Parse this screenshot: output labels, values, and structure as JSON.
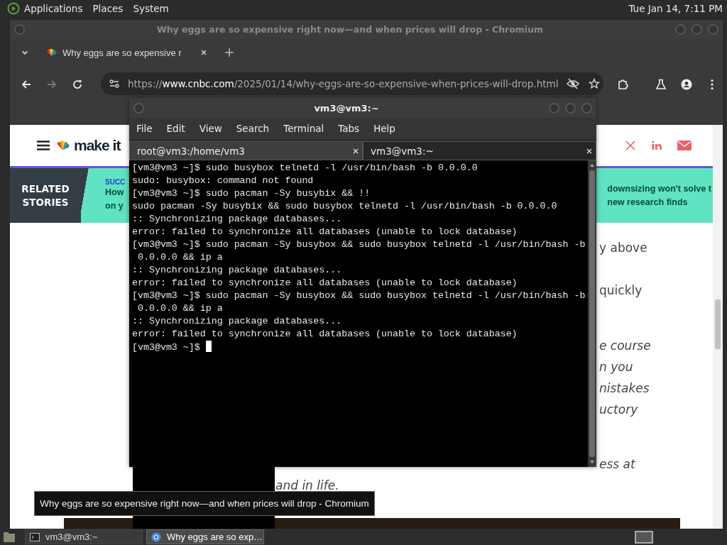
{
  "top_panel": {
    "menus": [
      "Applications",
      "Places",
      "System"
    ],
    "clock": "Tue Jan 14,  7:11 PM"
  },
  "browser": {
    "title": "Why eggs are so expensive right now—and when prices will drop - Chromium",
    "tab": {
      "title": "Why eggs are so expensive r"
    },
    "nav": {
      "forward_disabled": true
    },
    "url": {
      "scheme": "https://",
      "host": "www.cnbc.com",
      "path": "/2025/01/14/why-eggs-are-so-expensive-when-prices-will-drop.html"
    },
    "page": {
      "logo": "make it",
      "related": {
        "heading": "RELATED STORIES",
        "left_kicker": "SUCC",
        "left_lines": [
          "How",
          "on y"
        ],
        "right_lines": [
          "downsizing won't solve t",
          "new research finds"
        ]
      },
      "fragments": [
        {
          "text": "y above",
          "kind": "plain"
        },
        {
          "text": "quickly",
          "kind": "plain"
        },
        {
          "text": "e course",
          "kind": "italic"
        },
        {
          "text": "n you",
          "kind": "italic"
        },
        {
          "text": "nistakes",
          "kind": "italic"
        },
        {
          "text": "uctory",
          "kind": "italic"
        },
        {
          "text": "ess at",
          "kind": "italic"
        },
        {
          "text": "and in life.",
          "kind": "italic"
        }
      ]
    }
  },
  "terminal": {
    "title": "vm3@vm3:~",
    "menu": [
      "File",
      "Edit",
      "View",
      "Search",
      "Terminal",
      "Tabs",
      "Help"
    ],
    "tabs": [
      {
        "label": "root@vm3:/home/vm3",
        "selected": false
      },
      {
        "label": "vm3@vm3:~",
        "selected": true
      }
    ],
    "lines": [
      "[vm3@vm3 ~]$ sudo busybox telnetd -l /usr/bin/bash -b 0.0.0.0",
      "sudo: busybox: command not found",
      "[vm3@vm3 ~]$ sudo pacman -Sy busybix && !!",
      "sudo pacman -Sy busybix && sudo busybox telnetd -l /usr/bin/bash -b 0.0.0.0",
      ":: Synchronizing package databases...",
      "error: failed to synchronize all databases (unable to lock database)",
      "[vm3@vm3 ~]$ sudo pacman -Sy busybox && sudo busybox telnetd -l /usr/bin/bash -b",
      " 0.0.0.0 && ip a",
      ":: Synchronizing package databases...",
      "error: failed to synchronize all databases (unable to lock database)",
      "[vm3@vm3 ~]$ sudo pacman -Sy busybox && sudo busybox telnetd -l /usr/bin/bash -b",
      " 0.0.0.0 && ip a",
      ":: Synchronizing package databases...",
      "error: failed to synchronize all databases (unable to lock database)"
    ],
    "prompt": "[vm3@vm3 ~]$ "
  },
  "tooltip": "Why eggs are so expensive right now—and when prices will drop - Chromium",
  "taskbar": {
    "tasks": [
      {
        "label": "vm3@vm3:~",
        "kind": "terminal",
        "selected": false
      },
      {
        "label": "Why eggs are so exp…",
        "kind": "browser",
        "selected": true
      }
    ]
  }
}
